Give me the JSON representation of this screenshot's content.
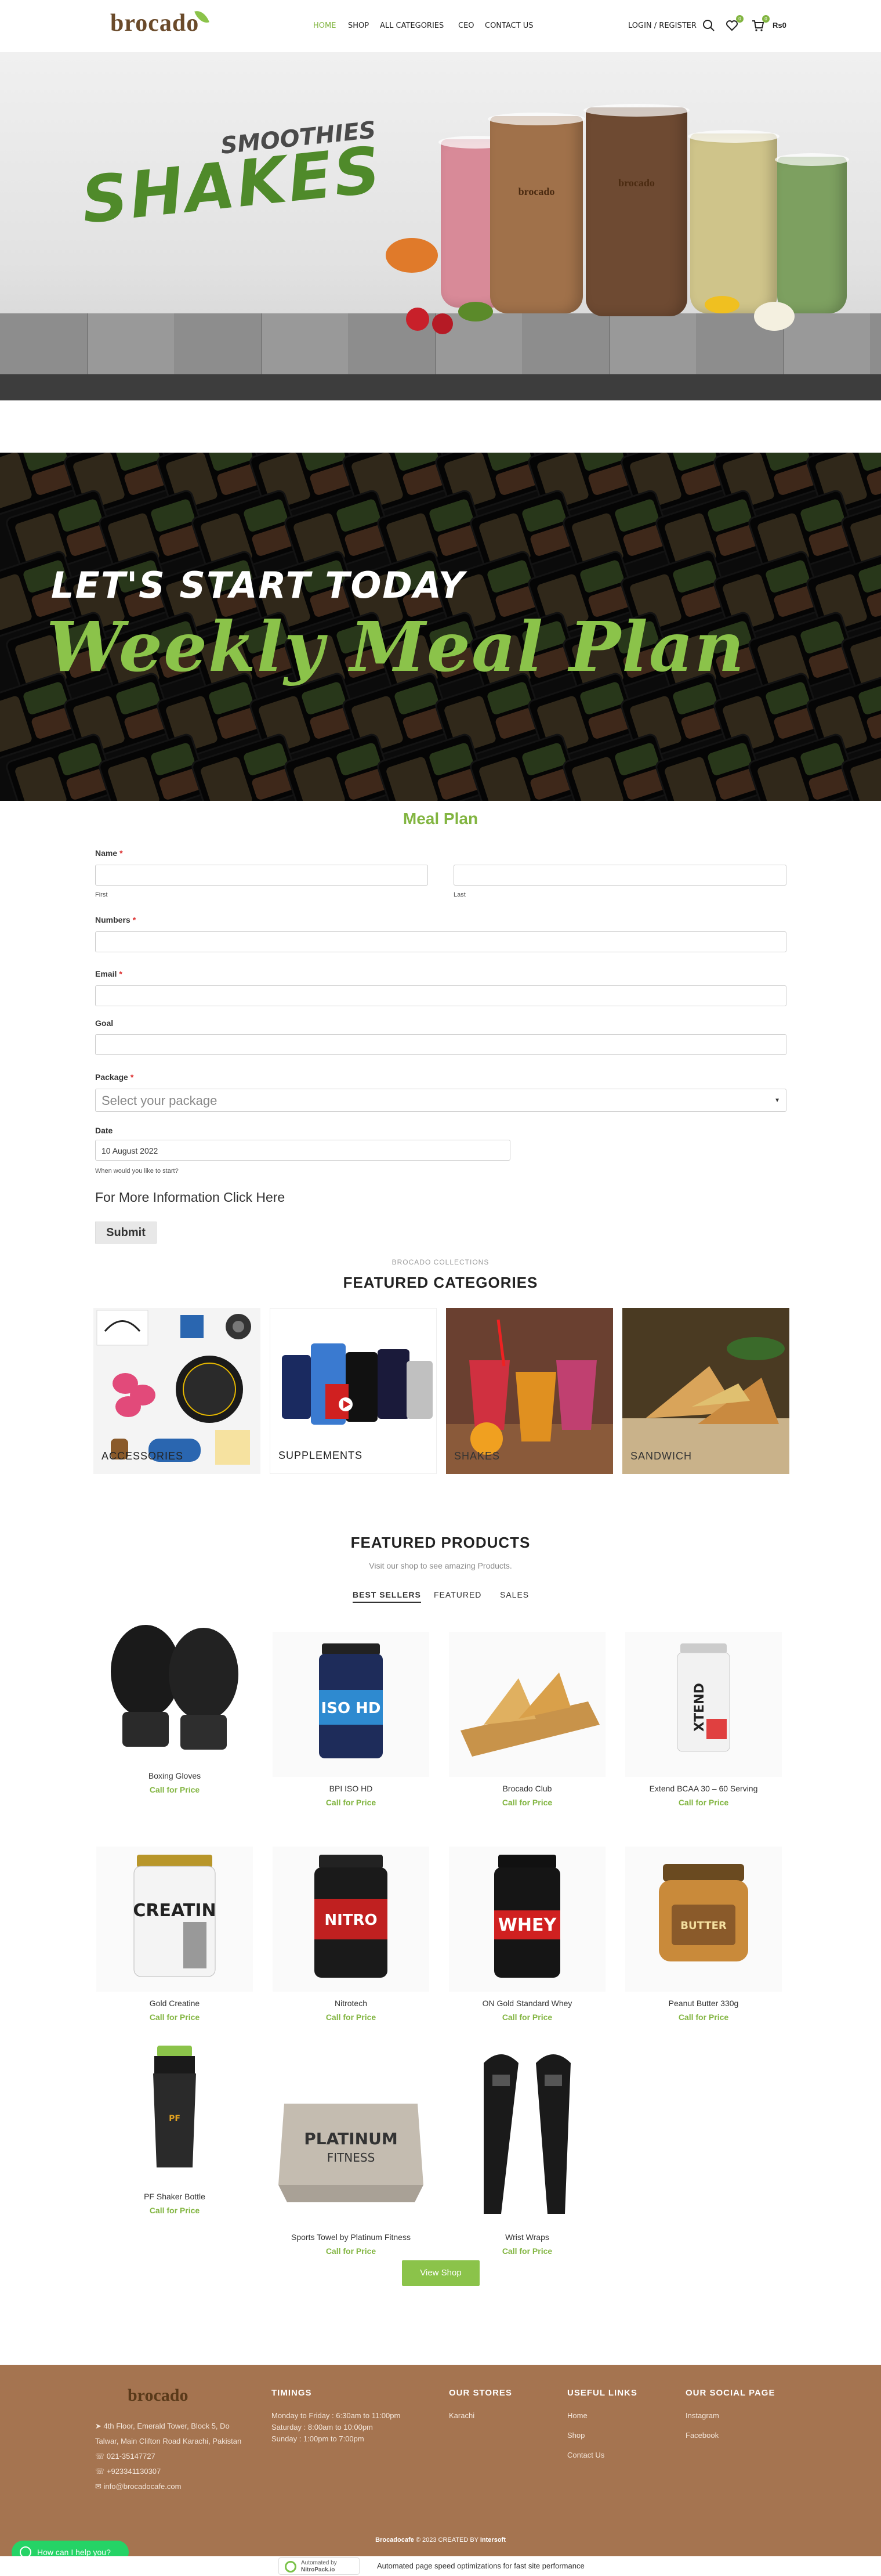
{
  "header": {
    "logo": "brocado",
    "nav": [
      "HOME",
      "SHOP",
      "ALL CATEGORIES",
      "CEO",
      "CONTACT US"
    ],
    "login": "LOGIN / REGISTER",
    "wishlist_count": "0",
    "cart_count": "0",
    "cart_total": "Rs0",
    "accent_color": "#82b541"
  },
  "hero": {
    "kicker": "SMOOTHIES",
    "title": "SHAKES",
    "glass_brand": "brocado",
    "slide_count": 5,
    "active_slide": 1
  },
  "meal_banner": {
    "subtitle": "LET'S START TODAY",
    "title": "Weekly Meal Plan"
  },
  "form": {
    "title": "Meal Plan",
    "name_label": "Name",
    "first_sub": "First",
    "last_sub": "Last",
    "numbers_label": "Numbers",
    "email_label": "Email",
    "goal_label": "Goal",
    "package_label": "Package",
    "package_placeholder": "Select your package",
    "date_label": "Date",
    "date_value": "10 August 2022",
    "date_hint": "When would you like to start?",
    "more_info": "For More Information Click Here",
    "submit": "Submit"
  },
  "categories": {
    "kicker": "BROCADO COLLECTIONS",
    "title": "FEATURED CATEGORIES",
    "items": [
      "ACCESSORIES",
      "SUPPLEMENTS",
      "SHAKES",
      "SANDWICH"
    ]
  },
  "products": {
    "title": "FEATURED PRODUCTS",
    "subtitle": "Visit our shop to see amazing Products.",
    "tabs": [
      "BEST SELLERS",
      "FEATURED",
      "SALES"
    ],
    "price_label": "Call for Price",
    "items": [
      {
        "name": "Boxing Gloves",
        "icon": "boxing-gloves-icon"
      },
      {
        "name": "BPI ISO HD",
        "icon": "protein-tub-icon"
      },
      {
        "name": "Brocado Club",
        "icon": "club-sandwich-icon"
      },
      {
        "name": "Extend BCAA 30 – 60 Serving",
        "icon": "bcaa-tub-icon"
      },
      {
        "name": "Gold Creatine",
        "icon": "creatine-tub-icon"
      },
      {
        "name": "Nitrotech",
        "icon": "nitrotech-tub-icon"
      },
      {
        "name": "ON Gold Standard Whey",
        "icon": "whey-tub-icon"
      },
      {
        "name": "Peanut Butter 330g",
        "icon": "peanut-butter-jar-icon"
      },
      {
        "name": "PF Shaker Bottle",
        "icon": "shaker-bottle-icon"
      },
      {
        "name": "Sports Towel by Platinum Fitness",
        "icon": "towel-icon"
      },
      {
        "name": "Wrist Wraps",
        "icon": "wrist-wraps-icon"
      }
    ],
    "view_shop": "View Shop"
  },
  "footer": {
    "logo": "brocado",
    "address_line1": "4th Floor, Emerald Tower, Block 5, Do",
    "address_line2": "Talwar, Main Clifton Road Karachi, Pakistan",
    "phone1": "021-35147727",
    "phone2": "+923341130307",
    "email": "info@brocadocafe.com",
    "timings_title": "TIMINGS",
    "timings": [
      "Monday to Friday : 6:30am to 11:00pm",
      "Saturday : 8:00am to 10:00pm",
      "Sunday : 1:00pm to 7:00pm"
    ],
    "stores_title": "OUR STORES",
    "stores": [
      "Karachi"
    ],
    "links_title": "USEFUL LINKS",
    "links": [
      "Home",
      "Shop",
      "Contact Us"
    ],
    "social_title": "OUR SOCIAL PAGE",
    "social": [
      "Instagram",
      "Facebook"
    ],
    "copyright_brand": "Brocadocafe",
    "copyright_rest": "© 2023 CREATED BY",
    "copyright_author": "Intersoft",
    "footer_color": "#a57450"
  },
  "whatsapp": {
    "label": "How can I help you?"
  },
  "nitro": {
    "badge_line1": "Automated by",
    "badge_line2": "NitroPack.io",
    "text": "Automated page speed optimizations for fast site performance"
  }
}
